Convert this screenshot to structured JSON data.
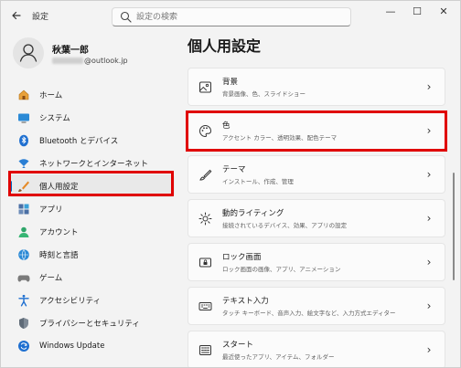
{
  "titlebar": {
    "app_title": "設定",
    "search_placeholder": "設定の検索",
    "minimize": "—",
    "maximize": "☐",
    "close": "✕"
  },
  "profile": {
    "name": "秋葉一郎",
    "email_suffix": "@outlook.jp"
  },
  "sidebar": {
    "items": [
      {
        "label": "ホーム",
        "icon": "home-icon"
      },
      {
        "label": "システム",
        "icon": "system-icon"
      },
      {
        "label": "Bluetooth とデバイス",
        "icon": "bluetooth-icon"
      },
      {
        "label": "ネットワークとインターネット",
        "icon": "network-icon"
      },
      {
        "label": "個人用設定",
        "icon": "personalization-icon",
        "selected": true
      },
      {
        "label": "アプリ",
        "icon": "apps-icon"
      },
      {
        "label": "アカウント",
        "icon": "accounts-icon"
      },
      {
        "label": "時刻と言語",
        "icon": "time-language-icon"
      },
      {
        "label": "ゲーム",
        "icon": "gaming-icon"
      },
      {
        "label": "アクセシビリティ",
        "icon": "accessibility-icon"
      },
      {
        "label": "プライバシーとセキュリティ",
        "icon": "privacy-icon"
      },
      {
        "label": "Windows Update",
        "icon": "windows-update-icon"
      }
    ]
  },
  "main": {
    "title": "個人用設定",
    "cards": [
      {
        "title": "背景",
        "subtitle": "背景画像、色、スライドショー",
        "icon": "image-icon"
      },
      {
        "title": "色",
        "subtitle": "アクセント カラー、透明効果、配色テーマ",
        "icon": "palette-icon"
      },
      {
        "title": "テーマ",
        "subtitle": "インストール、作成、管理",
        "icon": "brush-icon"
      },
      {
        "title": "動的ライティング",
        "subtitle": "接続されているデバイス、効果、アプリの設定",
        "icon": "lighting-icon"
      },
      {
        "title": "ロック画面",
        "subtitle": "ロック画面の画像、アプリ、アニメーション",
        "icon": "lock-screen-icon"
      },
      {
        "title": "テキスト入力",
        "subtitle": "タッチ キーボード、音声入力、絵文字など、入力方式エディター",
        "icon": "keyboard-icon"
      },
      {
        "title": "スタート",
        "subtitle": "最近使ったアプリ、アイテム、フォルダー",
        "icon": "start-icon"
      }
    ],
    "chevron": "›"
  },
  "colors": {
    "accent": "#0067c0",
    "highlight": "#e00000",
    "background": "#f3f3f3",
    "card": "#fbfbfb"
  }
}
